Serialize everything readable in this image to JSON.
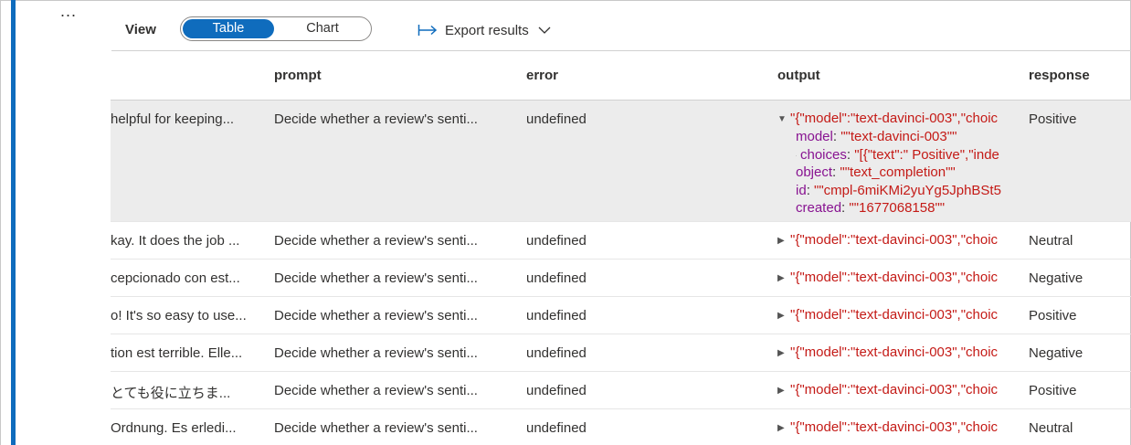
{
  "toolbar": {
    "more_label": "...",
    "view_label": "View",
    "view_options": [
      "Table",
      "Chart"
    ],
    "export_label": "Export results"
  },
  "table": {
    "columns": [
      "prompt",
      "error",
      "output",
      "response"
    ],
    "expanded_tree": [
      {
        "key": "model",
        "value": "\"\"text-davinci-003\"\"",
        "expandable": false
      },
      {
        "key": "choices",
        "value": "\"[{\"text\":\" Positive\",\"inde",
        "expandable": true
      },
      {
        "key": "object",
        "value": "\"\"text_completion\"\"",
        "expandable": false
      },
      {
        "key": "id",
        "value": "\"\"cmpl-6miKMi2yuYg5JphBSt5",
        "expandable": false
      },
      {
        "key": "created",
        "value": "\"\"1677068158\"\"",
        "expandable": false
      }
    ],
    "rows": [
      {
        "review": " helpful for keeping...",
        "prompt": "Decide whether a review's senti...",
        "error": "undefined",
        "output": "\"{\"model\":\"text-davinci-003\",\"choic",
        "response": "Positive"
      },
      {
        "review": "kay. It does the job ...",
        "prompt": "Decide whether a review's senti...",
        "error": "undefined",
        "output": "\"{\"model\":\"text-davinci-003\",\"choic",
        "response": "Neutral"
      },
      {
        "review": "cepcionado con est...",
        "prompt": "Decide whether a review's senti...",
        "error": "undefined",
        "output": "\"{\"model\":\"text-davinci-003\",\"choic",
        "response": "Negative"
      },
      {
        "review": "o! It's so easy to use...",
        "prompt": "Decide whether a review's senti...",
        "error": "undefined",
        "output": "\"{\"model\":\"text-davinci-003\",\"choic",
        "response": "Positive"
      },
      {
        "review": "tion est terrible. Elle...",
        "prompt": "Decide whether a review's senti...",
        "error": "undefined",
        "output": "\"{\"model\":\"text-davinci-003\",\"choic",
        "response": "Negative"
      },
      {
        "review": "とても役に立ちま...",
        "prompt": "Decide whether a review's senti...",
        "error": "undefined",
        "output": "\"{\"model\":\"text-davinci-003\",\"choic",
        "response": "Positive"
      },
      {
        "review": " Ordnung. Es erledi...",
        "prompt": "Decide whether a review's senti...",
        "error": "undefined",
        "output": "\"{\"model\":\"text-davinci-003\",\"choic",
        "response": "Neutral"
      }
    ]
  },
  "colors": {
    "accent": "#0f6cbd",
    "json_string": "#c41a16",
    "json_key": "#881391",
    "selected_row": "#ececec"
  },
  "icons": [
    "more-icon",
    "export-arrow-icon",
    "chevron-down-icon",
    "expand-triangle-icon",
    "collapse-triangle-icon"
  ]
}
